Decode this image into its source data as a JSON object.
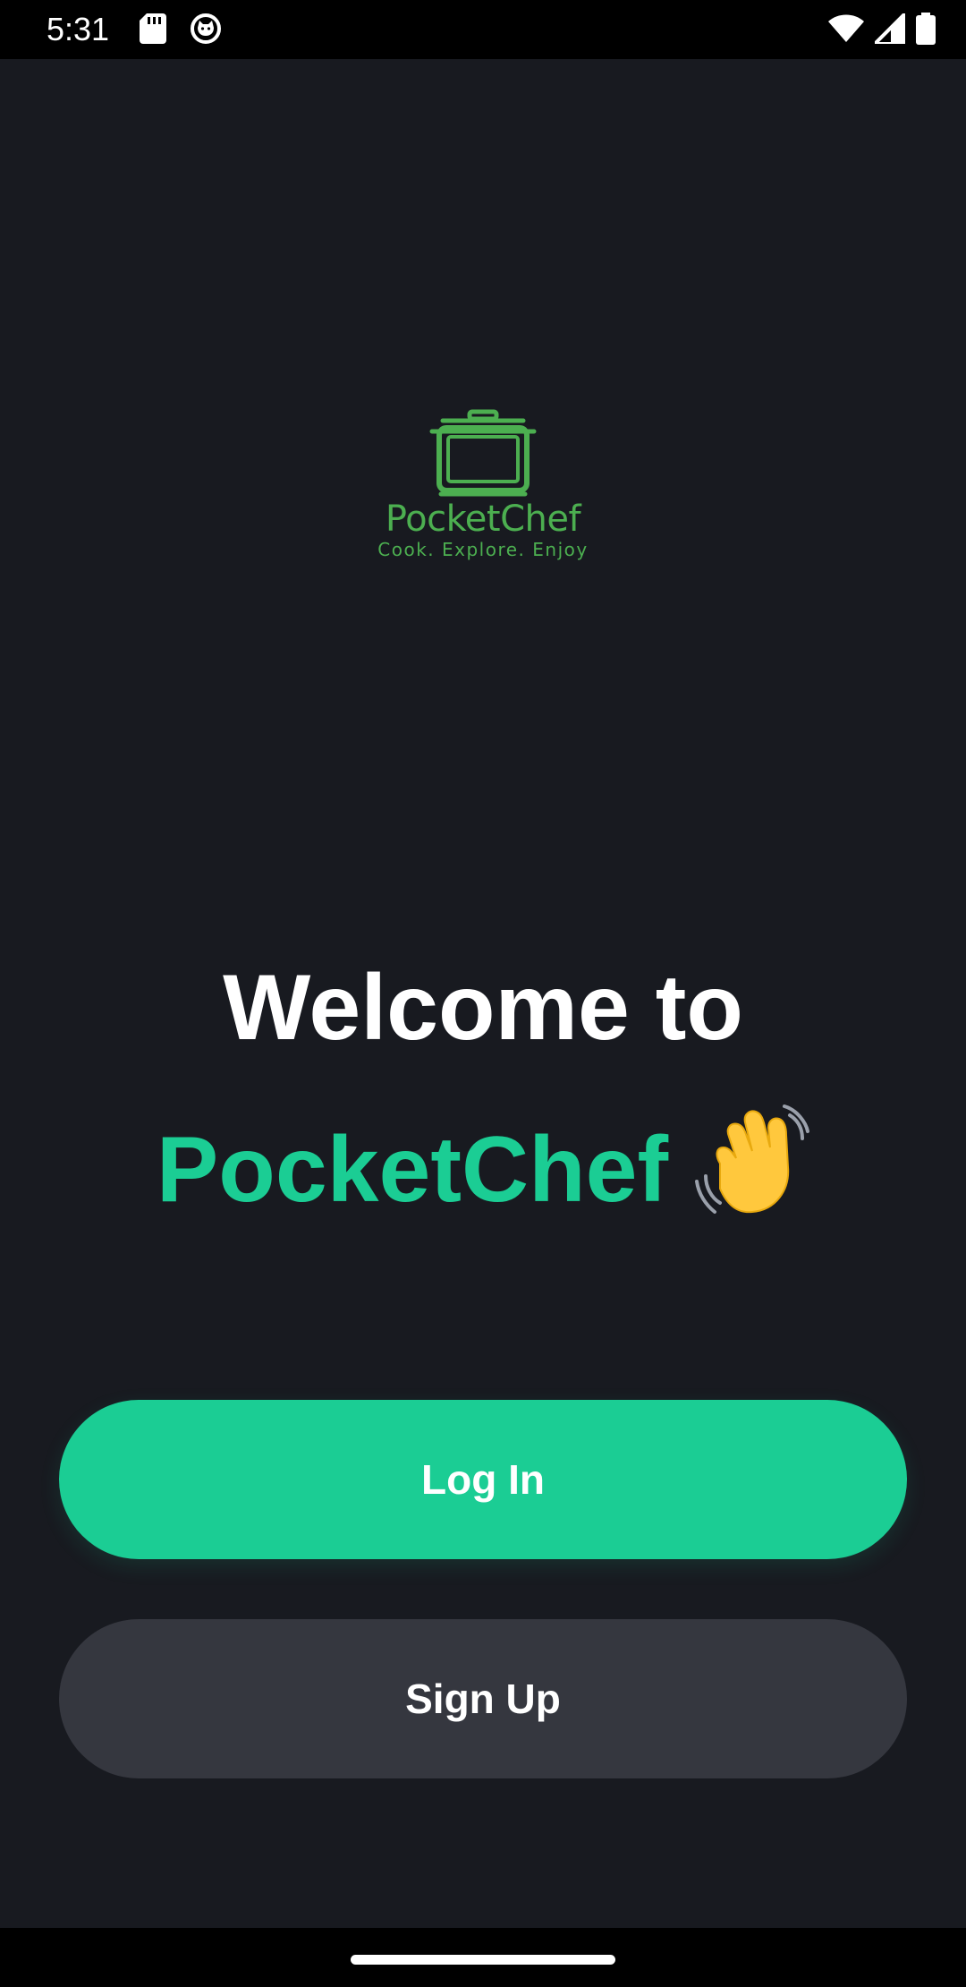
{
  "status_bar": {
    "time": "5:31",
    "icons": [
      "sd-card-icon",
      "cat-face-icon",
      "wifi-icon",
      "signal-icon",
      "battery-icon"
    ]
  },
  "logo": {
    "name": "PocketChef",
    "tagline": "Cook. Explore. Enjoy",
    "icon": "cooking-pot-icon",
    "color": "#4caf50"
  },
  "welcome": {
    "line1": "Welcome to",
    "line2": "PocketChef",
    "emoji": "waving-hand-icon"
  },
  "buttons": {
    "login_label": "Log In",
    "signup_label": "Sign Up"
  },
  "colors": {
    "background": "#181a20",
    "accent": "#1bcd94",
    "secondary_button": "#35373f"
  }
}
